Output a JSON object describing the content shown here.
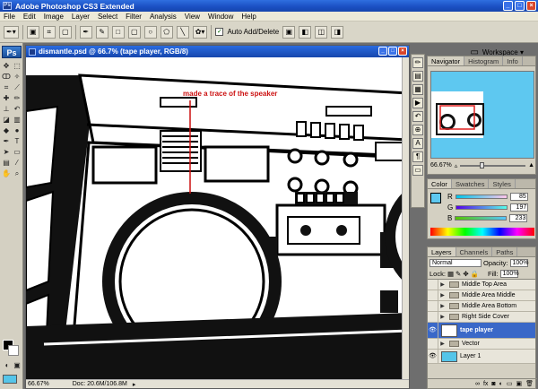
{
  "app": {
    "title": "Adobe Photoshop CS3 Extended",
    "logo": "Ps"
  },
  "menu": [
    "File",
    "Edit",
    "Image",
    "Layer",
    "Select",
    "Filter",
    "Analysis",
    "View",
    "Window",
    "Help"
  ],
  "options": {
    "auto_add_delete": "Auto Add/Delete",
    "workspace": "Workspace ▾"
  },
  "document": {
    "title": "dismantle.psd @ 66.7% (tape player, RGB/8)",
    "zoom": "66.67%",
    "doc_size": "Doc: 20.6M/106.8M",
    "annotation": "made a trace of the speaker"
  },
  "navigator": {
    "tabs": [
      "Navigator",
      "Histogram",
      "Info"
    ],
    "zoom": "66.67%"
  },
  "color": {
    "tabs": [
      "Color",
      "Swatches",
      "Styles"
    ],
    "channels": [
      {
        "label": "R",
        "value": "85"
      },
      {
        "label": "G",
        "value": "197"
      },
      {
        "label": "B",
        "value": "233"
      }
    ],
    "swatch": "#55c5e9"
  },
  "layers": {
    "tabs": [
      "Layers",
      "Channels",
      "Paths"
    ],
    "blend_mode": "Normal",
    "opacity_label": "Opacity:",
    "opacity": "100%",
    "lock_label": "Lock:",
    "fill_label": "Fill:",
    "fill": "100%",
    "rows": [
      {
        "name": "Middle Top Area",
        "type": "group",
        "visible": false,
        "selected": false
      },
      {
        "name": "Middle Area Middle",
        "type": "group",
        "visible": false,
        "selected": false
      },
      {
        "name": "Middle Area Bottom",
        "type": "group",
        "visible": false,
        "selected": false
      },
      {
        "name": "Right Side Cover",
        "type": "group",
        "visible": false,
        "selected": false
      },
      {
        "name": "tape player",
        "type": "layer",
        "visible": true,
        "selected": true
      },
      {
        "name": "Vector",
        "type": "group",
        "visible": false,
        "selected": false
      },
      {
        "name": "Layer 1",
        "type": "layer",
        "visible": true,
        "selected": false
      }
    ]
  }
}
